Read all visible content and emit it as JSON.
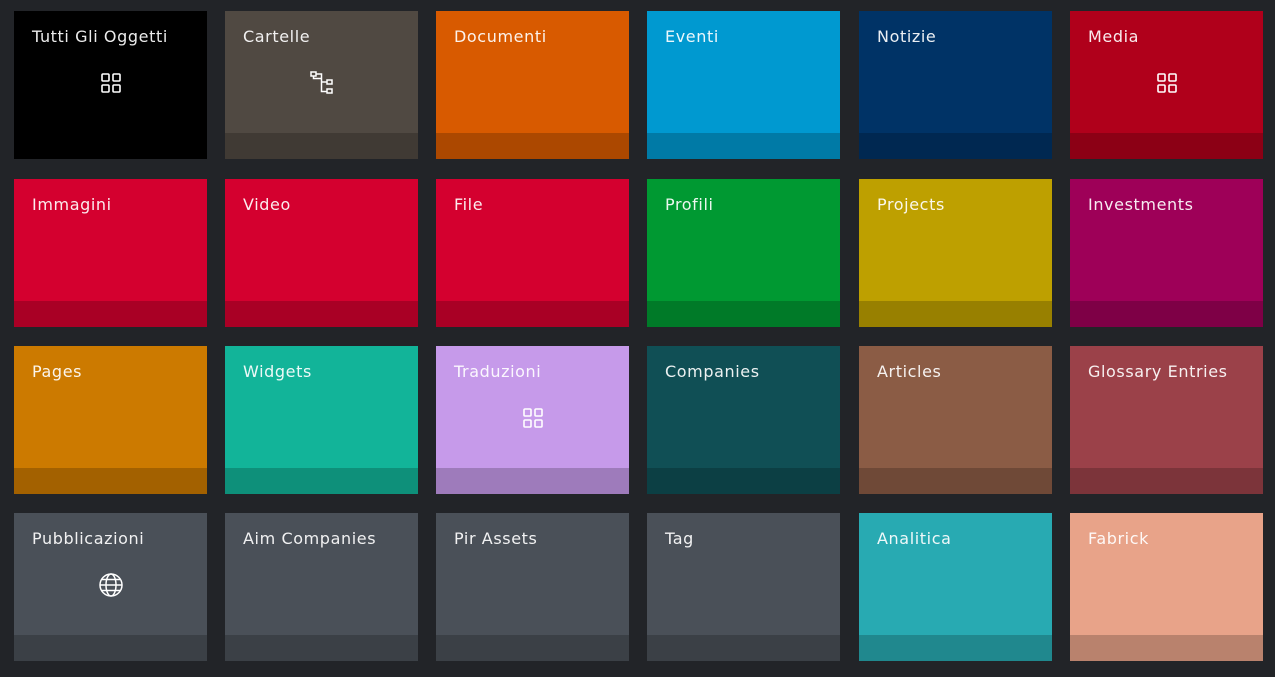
{
  "tiles": [
    {
      "label": "Tutti Gli Oggetti",
      "color": "#000000",
      "icon": "grid-icon"
    },
    {
      "label": "Cartelle",
      "color": "#504942",
      "icon": "folder-tree-icon"
    },
    {
      "label": "Documenti",
      "color": "#d85a00",
      "icon": ""
    },
    {
      "label": "Eventi",
      "color": "#0099d0",
      "icon": ""
    },
    {
      "label": "Notizie",
      "color": "#003366",
      "icon": ""
    },
    {
      "label": "Media",
      "color": "#b0001b",
      "icon": "grid-icon"
    },
    {
      "label": "Immagini",
      "color": "#d4002f",
      "icon": ""
    },
    {
      "label": "Video",
      "color": "#d4002f",
      "icon": ""
    },
    {
      "label": "File",
      "color": "#d4002f",
      "icon": ""
    },
    {
      "label": "Profili",
      "color": "#009932",
      "icon": ""
    },
    {
      "label": "Projects",
      "color": "#bea000",
      "icon": ""
    },
    {
      "label": "Investments",
      "color": "#9e0058",
      "icon": ""
    },
    {
      "label": "Pages",
      "color": "#cc7a00",
      "icon": ""
    },
    {
      "label": "Widgets",
      "color": "#12b499",
      "icon": ""
    },
    {
      "label": "Traduzioni",
      "color": "#c69aea",
      "icon": "grid-icon"
    },
    {
      "label": "Companies",
      "color": "#104f55",
      "icon": ""
    },
    {
      "label": "Articles",
      "color": "#8b5c45",
      "icon": ""
    },
    {
      "label": "Glossary Entries",
      "color": "#9b4149",
      "icon": ""
    },
    {
      "label": "Pubblicazioni",
      "color": "#4a5058",
      "icon": "globe-icon"
    },
    {
      "label": "Aim Companies",
      "color": "#4a5058",
      "icon": ""
    },
    {
      "label": "Pir Assets",
      "color": "#4a5058",
      "icon": ""
    },
    {
      "label": "Tag",
      "color": "#4a5058",
      "icon": ""
    },
    {
      "label": "Analitica",
      "color": "#28aab2",
      "icon": ""
    },
    {
      "label": "Fabrick",
      "color": "#e8a389",
      "icon": ""
    }
  ]
}
